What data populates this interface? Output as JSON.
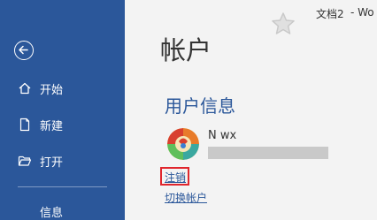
{
  "window": {
    "doc_title": "文档2",
    "doc_title_cut": "-  Wo"
  },
  "sidebar": {
    "back_icon": "back-arrow-icon",
    "items": [
      {
        "label": "开始",
        "icon": "home-icon"
      },
      {
        "label": "新建",
        "icon": "new-document-icon"
      },
      {
        "label": "打开",
        "icon": "folder-open-icon"
      },
      {
        "label": "信息"
      }
    ],
    "accent": "#2b579a"
  },
  "main": {
    "page_title": "帐户",
    "section_title": "用户信息",
    "user_name": "N wx",
    "signout_label": "注销",
    "switch_account_label": "切换帐户",
    "highlight_color": "#e0262d"
  }
}
